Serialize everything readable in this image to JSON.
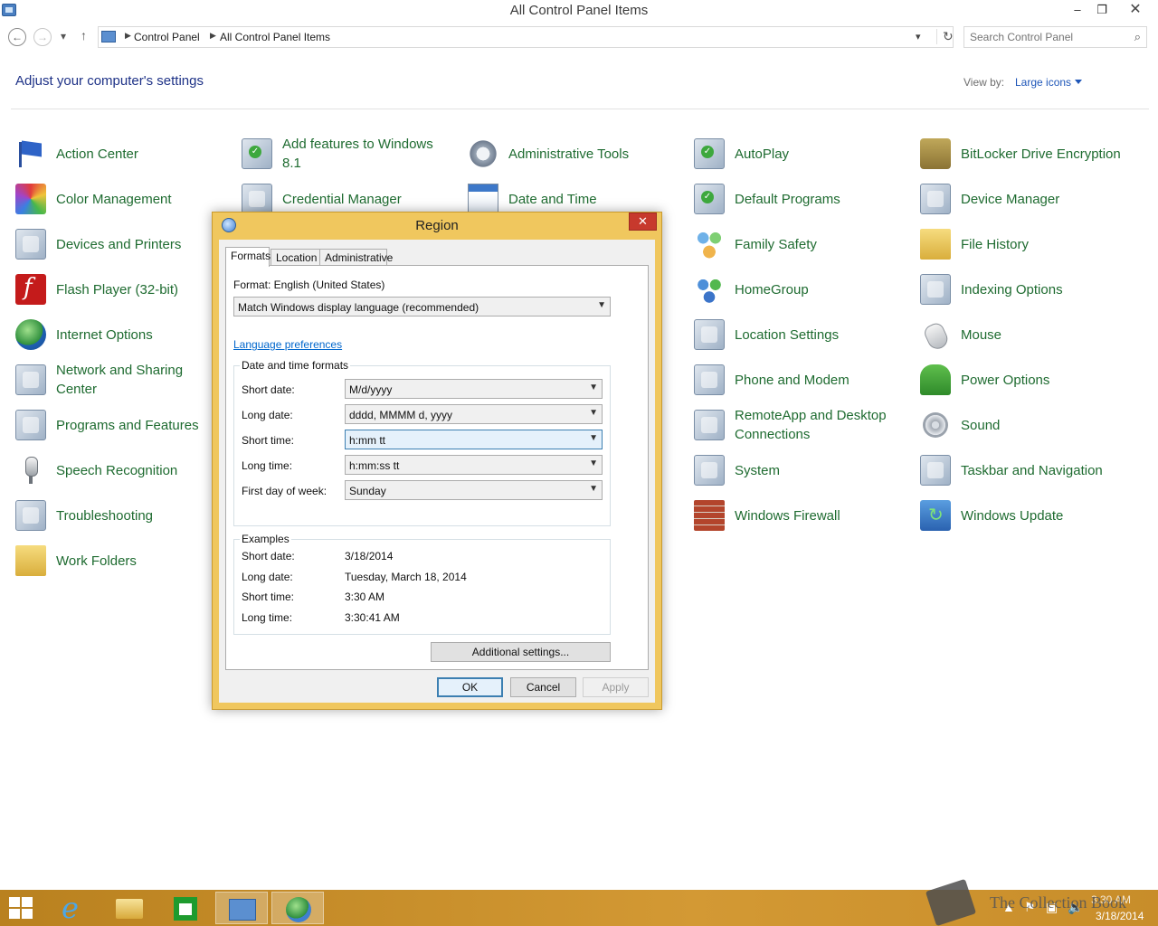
{
  "window": {
    "title": "All Control Panel Items"
  },
  "titlebar_buttons": {
    "minimize": "‒",
    "maximize": "❐",
    "close": "✕"
  },
  "address": {
    "crumbs": [
      "Control Panel",
      "All Control Panel Items"
    ],
    "search_placeholder": "Search Control Panel"
  },
  "header": {
    "heading": "Adjust your computer's settings",
    "view_by_label": "View by:",
    "view_by_value": "Large icons"
  },
  "items": [
    {
      "label": "Action Center",
      "icon": "flag-icon"
    },
    {
      "label": "Add features to Windows 8.1",
      "icon": "add-features-icon"
    },
    {
      "label": "Administrative Tools",
      "icon": "admin-tools-icon"
    },
    {
      "label": "AutoPlay",
      "icon": "autoplay-icon"
    },
    {
      "label": "BitLocker Drive Encryption",
      "icon": "bitlocker-icon"
    },
    {
      "label": "Color Management",
      "icon": "color-management-icon"
    },
    {
      "label": "Credential Manager",
      "icon": "credential-manager-icon"
    },
    {
      "label": "Date and Time",
      "icon": "calendar-icon"
    },
    {
      "label": "Default Programs",
      "icon": "default-programs-icon"
    },
    {
      "label": "Device Manager",
      "icon": "device-manager-icon"
    },
    {
      "label": "Devices and Printers",
      "icon": "printer-icon"
    },
    {
      "label": "Family Safety",
      "icon": "family-safety-icon"
    },
    {
      "label": "File History",
      "icon": "file-history-icon"
    },
    {
      "label": "Flash Player (32-bit)",
      "icon": "flash-icon"
    },
    {
      "label": "HomeGroup",
      "icon": "homegroup-icon"
    },
    {
      "label": "Indexing Options",
      "icon": "indexing-icon"
    },
    {
      "label": "Internet Options",
      "icon": "internet-options-icon"
    },
    {
      "label": "Location Settings",
      "icon": "location-icon"
    },
    {
      "label": "Mouse",
      "icon": "mouse-icon"
    },
    {
      "label": "Network and Sharing Center",
      "icon": "network-icon"
    },
    {
      "label": "Phone and Modem",
      "icon": "phone-icon"
    },
    {
      "label": "Power Options",
      "icon": "power-icon"
    },
    {
      "label": "Programs and Features",
      "icon": "programs-icon"
    },
    {
      "label": "RemoteApp and Desktop Connections",
      "icon": "remoteapp-icon"
    },
    {
      "label": "Sound",
      "icon": "speaker-icon"
    },
    {
      "label": "Speech Recognition",
      "icon": "microphone-icon"
    },
    {
      "label": "System",
      "icon": "system-icon"
    },
    {
      "label": "Taskbar and Navigation",
      "icon": "taskbar-icon"
    },
    {
      "label": "Troubleshooting",
      "icon": "troubleshooting-icon"
    },
    {
      "label": "Windows Firewall",
      "icon": "firewall-icon"
    },
    {
      "label": "Windows Update",
      "icon": "windows-update-icon"
    },
    {
      "label": "Work Folders",
      "icon": "work-folders-icon"
    }
  ],
  "dialog": {
    "title": "Region",
    "close": "✕",
    "tabs": [
      "Formats",
      "Location",
      "Administrative"
    ],
    "format_label": "Format: English (United States)",
    "format_value": "Match Windows display language (recommended)",
    "language_link": "Language preferences",
    "dt_group_title": "Date and time formats",
    "fields": [
      {
        "label": "Short date:",
        "value": "M/d/yyyy"
      },
      {
        "label": "Long date:",
        "value": "dddd, MMMM d, yyyy"
      },
      {
        "label": "Short time:",
        "value": "h:mm tt"
      },
      {
        "label": "Long time:",
        "value": "h:mm:ss tt"
      },
      {
        "label": "First day of week:",
        "value": "Sunday"
      }
    ],
    "examples_title": "Examples",
    "examples": [
      {
        "label": "Short date:",
        "value": "3/18/2014"
      },
      {
        "label": "Long date:",
        "value": "Tuesday, March 18, 2014"
      },
      {
        "label": "Short time:",
        "value": "3:30 AM"
      },
      {
        "label": "Long time:",
        "value": "3:30:41 AM"
      }
    ],
    "additional": "Additional settings...",
    "ok": "OK",
    "cancel": "Cancel",
    "apply": "Apply"
  },
  "taskbar": {
    "time": "3:30 AM",
    "date": "3/18/2014",
    "watermark": "The Collection Book"
  }
}
